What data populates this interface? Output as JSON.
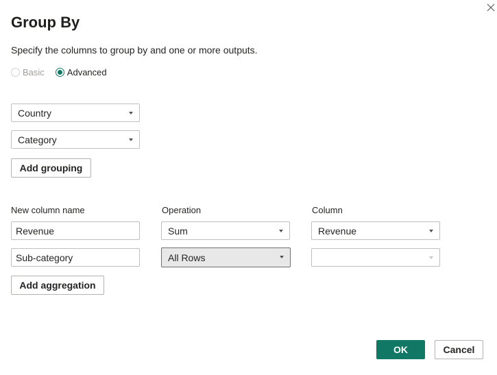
{
  "dialog": {
    "title": "Group By",
    "description": "Specify the columns to group by and one or more outputs.",
    "close_icon": "close-icon"
  },
  "mode": {
    "options": [
      {
        "label": "Basic",
        "selected": false,
        "enabled": false
      },
      {
        "label": "Advanced",
        "selected": true,
        "enabled": true
      }
    ]
  },
  "grouping": {
    "columns": [
      "Country",
      "Category"
    ],
    "add_button": "Add grouping"
  },
  "aggregation": {
    "headers": {
      "name": "New column name",
      "operation": "Operation",
      "column": "Column"
    },
    "rows": [
      {
        "name": "Revenue",
        "operation": "Sum",
        "column": "Revenue"
      },
      {
        "name": "Sub-category",
        "operation": "All Rows",
        "column": ""
      }
    ],
    "add_button": "Add aggregation"
  },
  "footer": {
    "ok_label": "OK",
    "cancel_label": "Cancel"
  },
  "colors": {
    "accent": "#117865",
    "border": "#bfbfbf",
    "active_dropdown_bg": "#e8e8e8"
  }
}
